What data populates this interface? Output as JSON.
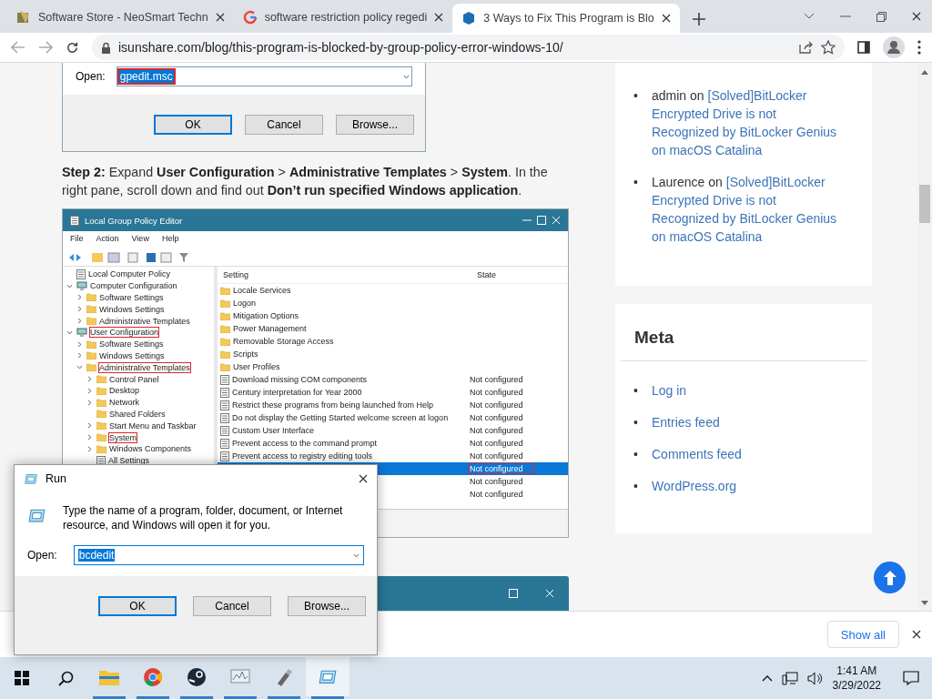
{
  "browser": {
    "tabs": [
      {
        "title": "Software Store - NeoSmart Techn",
        "selected": false
      },
      {
        "title": "software restriction policy regedi",
        "selected": false
      },
      {
        "title": "3 Ways to Fix This Program is Blo",
        "selected": true
      }
    ],
    "url": "isunshare.com/blog/this-program-is-blocked-by-group-policy-error-windows-10/"
  },
  "article": {
    "run_screenshot": {
      "open_label": "Open:",
      "command": "gpedit.msc",
      "buttons": [
        {
          "label": "OK",
          "default": true
        },
        {
          "label": "Cancel",
          "default": false
        },
        {
          "label": "Browse...",
          "default": false
        }
      ]
    },
    "step_text": "**Step 2:** Expand **User Configuration** > **Administrative Templates** > **System**. In the right pane, scroll down and find out **Don’t run specified Windows application**.",
    "gpe_screenshot": {
      "title": "Local Group Policy Editor",
      "menu": [
        "File",
        "Action",
        "View",
        "Help"
      ],
      "tree": [
        {
          "label": "Local Computer Policy",
          "kind": "root",
          "highlighted": false,
          "children": [
            {
              "label": "Computer Configuration",
              "kind": "computer",
              "expandable": true,
              "expanded": true,
              "highlighted": false,
              "children": [
                {
                  "label": "Software Settings",
                  "kind": "folder",
                  "expandable": true,
                  "expanded": false,
                  "highlighted": false
                },
                {
                  "label": "Windows Settings",
                  "kind": "folder",
                  "expandable": true,
                  "expanded": false,
                  "highlighted": false
                },
                {
                  "label": "Administrative Templates",
                  "kind": "folder",
                  "expandable": true,
                  "expanded": false,
                  "highlighted": false
                }
              ]
            },
            {
              "label": "User Configuration",
              "kind": "computer",
              "expandable": true,
              "expanded": true,
              "highlighted": true,
              "children": [
                {
                  "label": "Software Settings",
                  "kind": "folder",
                  "expandable": true,
                  "expanded": false,
                  "highlighted": false
                },
                {
                  "label": "Windows Settings",
                  "kind": "folder",
                  "expandable": true,
                  "expanded": false,
                  "highlighted": false
                },
                {
                  "label": "Administrative Templates",
                  "kind": "folder",
                  "expandable": true,
                  "expanded": true,
                  "highlighted": true,
                  "children": [
                    {
                      "label": "Control Panel",
                      "kind": "folder",
                      "expandable": true,
                      "expanded": false,
                      "highlighted": false
                    },
                    {
                      "label": "Desktop",
                      "kind": "folder",
                      "expandable": true,
                      "expanded": false,
                      "highlighted": false
                    },
                    {
                      "label": "Network",
                      "kind": "folder",
                      "expandable": true,
                      "expanded": false,
                      "highlighted": false
                    },
                    {
                      "label": "Shared Folders",
                      "kind": "folder",
                      "expandable": false,
                      "expanded": false,
                      "highlighted": false
                    },
                    {
                      "label": "Start Menu and Taskbar",
                      "kind": "folder",
                      "expandable": true,
                      "expanded": false,
                      "highlighted": false
                    },
                    {
                      "label": "System",
                      "kind": "folder",
                      "expandable": true,
                      "expanded": false,
                      "highlighted": true
                    },
                    {
                      "label": "Windows Components",
                      "kind": "folder",
                      "expandable": true,
                      "expanded": false,
                      "highlighted": false
                    },
                    {
                      "label": "All Settings",
                      "kind": "settings",
                      "expandable": false,
                      "expanded": false,
                      "highlighted": false
                    }
                  ]
                }
              ]
            }
          ]
        }
      ],
      "columns": [
        "Setting",
        "State"
      ],
      "rows": [
        {
          "name": "Locale Services",
          "kind": "folder",
          "selected": false,
          "highlighted": false
        },
        {
          "name": "Logon",
          "kind": "folder",
          "selected": false,
          "highlighted": false
        },
        {
          "name": "Mitigation Options",
          "kind": "folder",
          "selected": false,
          "highlighted": false
        },
        {
          "name": "Power Management",
          "kind": "folder",
          "selected": false,
          "highlighted": false
        },
        {
          "name": "Removable Storage Access",
          "kind": "folder",
          "selected": false,
          "highlighted": false
        },
        {
          "name": "Scripts",
          "kind": "folder",
          "selected": false,
          "highlighted": false
        },
        {
          "name": "User Profiles",
          "kind": "folder",
          "selected": false,
          "highlighted": false
        },
        {
          "name": "Download missing COM components",
          "kind": "setting",
          "state": "Not configured",
          "selected": false,
          "highlighted": false
        },
        {
          "name": "Century interpretation for Year 2000",
          "kind": "setting",
          "state": "Not configured",
          "selected": false,
          "highlighted": false
        },
        {
          "name": "Restrict these programs from being launched from Help",
          "kind": "setting",
          "state": "Not configured",
          "selected": false,
          "highlighted": false
        },
        {
          "name": "Do not display the Getting Started welcome screen at logon",
          "kind": "setting",
          "state": "Not configured",
          "selected": false,
          "highlighted": false
        },
        {
          "name": "Custom User Interface",
          "kind": "setting",
          "state": "Not configured",
          "selected": false,
          "highlighted": false
        },
        {
          "name": "Prevent access to the command prompt",
          "kind": "setting",
          "state": "Not configured",
          "selected": false,
          "highlighted": false
        },
        {
          "name": "Prevent access to registry editing tools",
          "kind": "setting",
          "state": "Not configured",
          "selected": false,
          "highlighted": false
        },
        {
          "kind": "setting",
          "state": "Not configured",
          "selected": true,
          "highlighted": true
        },
        {
          "kind": "setting",
          "state": "Not configured",
          "selected": false,
          "highlighted": false
        },
        {
          "kind": "setting",
          "state": "Not configured",
          "selected": false,
          "highlighted": false
        }
      ]
    }
  },
  "sidebar": {
    "bullet": "•",
    "comments": [
      {
        "author": "admin",
        "on": "on",
        "post": "[Solved]BitLocker Encrypted Drive is not Recognized by BitLocker Genius on macOS Catalina"
      },
      {
        "author": "Laurence",
        "on": "on",
        "post": "[Solved]BitLocker Encrypted Drive is not Recognized by BitLocker Genius on macOS Catalina"
      }
    ],
    "meta": {
      "title": "Meta",
      "links": [
        "Log in",
        "Entries feed",
        "Comments feed",
        "WordPress.org"
      ]
    }
  },
  "run_dialog": {
    "title": "Run",
    "description": "Type the name of a program, folder, document, or Internet resource, and Windows will open it for you.",
    "open_label": "Open:",
    "command": "bcdedit",
    "buttons": [
      {
        "label": "OK",
        "default": true
      },
      {
        "label": "Cancel",
        "default": false
      },
      {
        "label": "Browse...",
        "default": false
      }
    ]
  },
  "download_bar": {
    "show_all": "Show all"
  },
  "taskbar": {
    "apps": [
      {
        "kind": "explorer",
        "running": true,
        "active": false
      },
      {
        "kind": "chrome",
        "running": true,
        "active": false
      },
      {
        "kind": "steam",
        "running": true,
        "active": false
      },
      {
        "kind": "monitor",
        "running": true,
        "active": false
      },
      {
        "kind": "tool",
        "running": true,
        "active": false
      },
      {
        "kind": "run",
        "running": true,
        "active": true
      }
    ],
    "time": "1:41 AM",
    "date": "3/29/2022"
  }
}
